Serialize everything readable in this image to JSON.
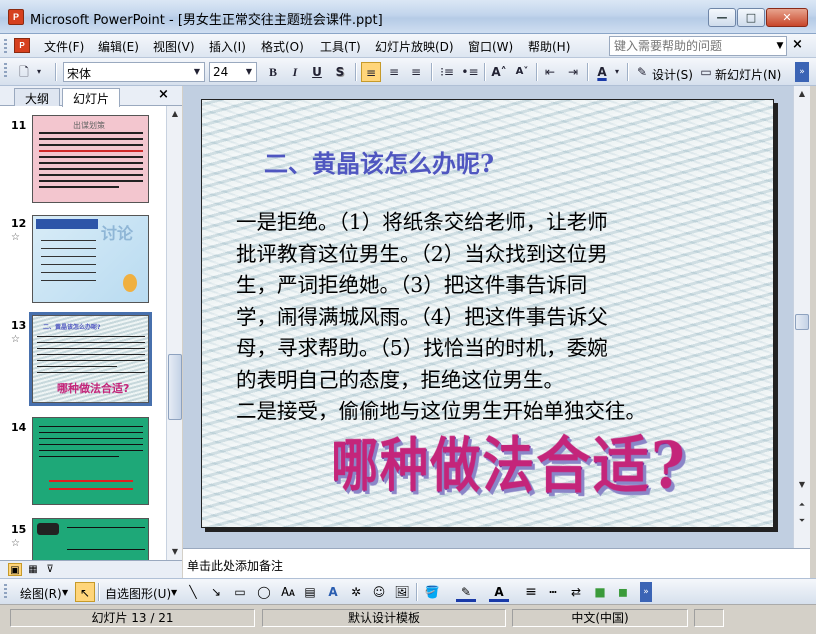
{
  "window": {
    "title": "Microsoft PowerPoint - [男女生正常交往主题班会课件.ppt]",
    "app_icon_label": "P",
    "minimize": "—",
    "maximize": "□",
    "close": "✕"
  },
  "menu": {
    "items": [
      "文件(F)",
      "编辑(E)",
      "视图(V)",
      "插入(I)",
      "格式(O)",
      "工具(T)",
      "幻灯片放映(D)",
      "窗口(W)",
      "帮助(H)"
    ],
    "help_placeholder": "键入需要帮助的问题",
    "close_doc": "×"
  },
  "toolbar": {
    "font": "宋体",
    "size": "24",
    "bold": "B",
    "italic": "I",
    "underline": "U",
    "shadow": "S",
    "design_label": "设计(S)",
    "new_slide_label": "新幻灯片(N)"
  },
  "left_pane": {
    "tab_outline": "大纲",
    "tab_slides": "幻灯片",
    "close": "×",
    "slides": [
      {
        "number": "11",
        "star": ""
      },
      {
        "number": "12",
        "star": "☆"
      },
      {
        "number": "13",
        "star": "☆"
      },
      {
        "number": "14",
        "star": ""
      },
      {
        "number": "15",
        "star": "☆"
      }
    ],
    "thumb_titles": {
      "t11": "出谋划策",
      "t12": "讨论",
      "t13": "二、黄晶该怎么办呢?",
      "t13_wordart": "哪种做法合适?"
    }
  },
  "slide": {
    "heading": "二、黄晶该怎么办呢?",
    "body_lines": [
      "一是拒绝。（1）将纸条交给老师，让老师",
      "批评教育这位男生。（2）当众找到这位男",
      "生，严词拒绝她。（3）把这件事告诉同",
      "学，闹得满城风雨。（4）把这件事告诉父",
      "母，寻求帮助。（5）找恰当的时机，委婉",
      "的表明自己的态度，拒绝这位男生。",
      "二是接受，偷偷地与这位男生开始单独交往。"
    ],
    "wordart": "哪种做法合适?"
  },
  "notes": {
    "placeholder": "单击此处添加备注"
  },
  "drawbar": {
    "draw_label": "绘图(R)",
    "autoshapes_label": "自选图形(U)"
  },
  "status": {
    "slide_info": "幻灯片 13 / 21",
    "template": "默认设计模板",
    "language": "中文(中国)"
  },
  "colors": {
    "heading": "#4f56c0",
    "wordart": "#c4257a",
    "selection": "#4770ad"
  }
}
